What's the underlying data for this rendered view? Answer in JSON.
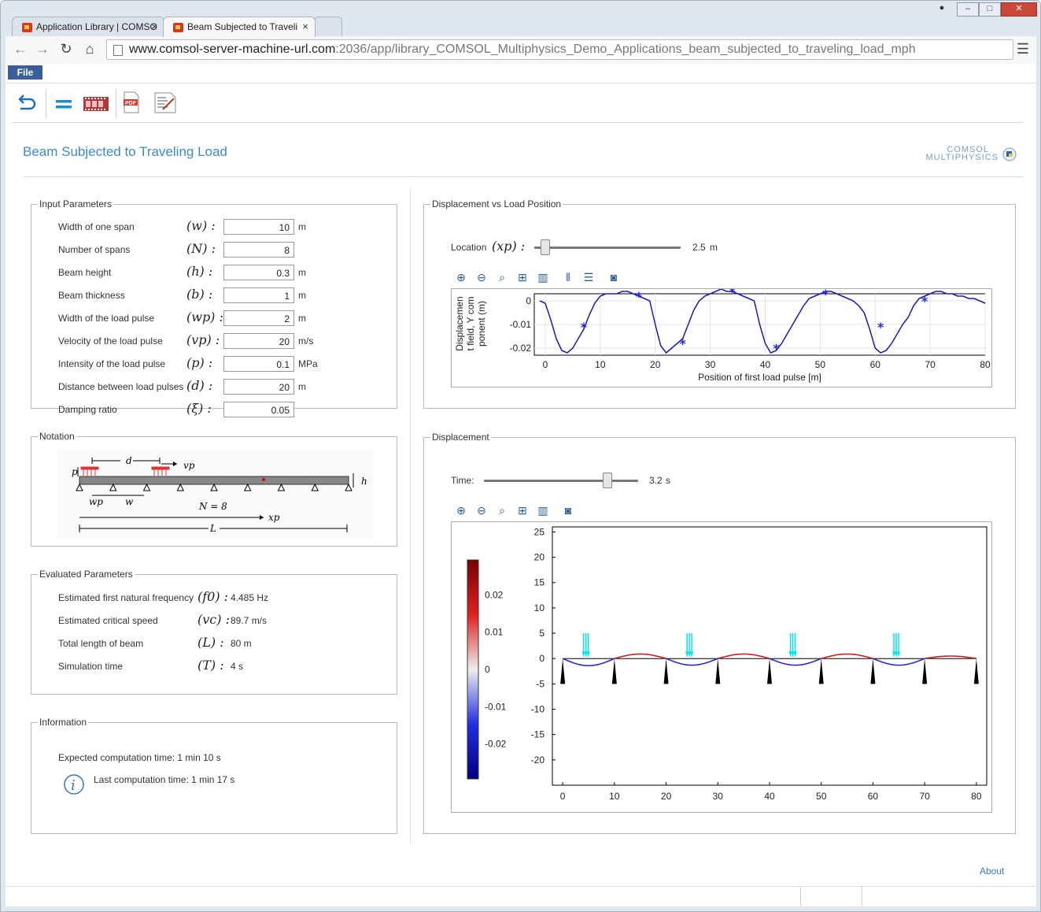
{
  "browser": {
    "tabs": [
      {
        "label": "Application Library | COMSO"
      },
      {
        "label": "Beam Subjected to Traveli"
      }
    ],
    "url_host": "www.comsol-server-machine-url.com",
    "url_rest": ":2036/app/library_COMSOL_Multiphysics_Demo_Applications_beam_subjected_to_traveling_load_mph"
  },
  "menu": {
    "file": "File"
  },
  "toolbar": {
    "icons": [
      "undo-icon",
      "equals-icon",
      "filmstrip-icon",
      "pdf-icon",
      "report-icon"
    ]
  },
  "header": {
    "title": "Beam Subjected to Traveling Load",
    "logo_line1": "COMSOL",
    "logo_line2": "MULTIPHYSICS"
  },
  "input": {
    "legend": "Input Parameters",
    "rows": [
      {
        "label": "Width of one span",
        "sym": "(w) :",
        "value": "10",
        "unit": "m"
      },
      {
        "label": "Number of spans",
        "sym": "(N) :",
        "value": "8",
        "unit": ""
      },
      {
        "label": "Beam height",
        "sym": "(h) :",
        "value": "0.3",
        "unit": "m"
      },
      {
        "label": "Beam thickness",
        "sym": "(b) :",
        "value": "1",
        "unit": "m"
      },
      {
        "label": "Width of the load pulse",
        "sym": "(wp) :",
        "value": "2",
        "unit": "m"
      },
      {
        "label": "Velocity of the load pulse",
        "sym": "(vp) :",
        "value": "20",
        "unit": "m/s"
      },
      {
        "label": "Intensity of the load pulse",
        "sym": "(p) :",
        "value": "0.1",
        "unit": "MPa"
      },
      {
        "label": "Distance between load pulses",
        "sym": "(d) :",
        "value": "20",
        "unit": "m"
      },
      {
        "label": "Damping ratio",
        "sym": "(ξ) :",
        "value": "0.05",
        "unit": ""
      }
    ]
  },
  "notation": {
    "legend": "Notation",
    "labels": {
      "p": "p",
      "d": "d",
      "vp": "vp",
      "h": "h",
      "wp": "wp",
      "w": "w",
      "N": "N = 8",
      "xp": "xp",
      "L": "L"
    }
  },
  "evaluated": {
    "legend": "Evaluated Parameters",
    "rows": [
      {
        "label": "Estimated first natural frequency",
        "sym": "(f0) :",
        "value": "4.485 Hz"
      },
      {
        "label": "Estimated critical speed",
        "sym": "(vc) :",
        "value": "89.7 m/s"
      },
      {
        "label": "Total length of beam",
        "sym": "(L) :",
        "value": "80 m"
      },
      {
        "label": "Simulation time",
        "sym": "(T) :",
        "value": "4 s"
      }
    ]
  },
  "information": {
    "legend": "Information",
    "expected": "Expected computation time: 1 min 10 s",
    "last": "Last computation time: 1 min 17 s"
  },
  "plot1": {
    "legend": "Displacement vs Load Position",
    "slider_label": "Location",
    "slider_sym": "(xp) :",
    "slider_value": "2.5",
    "slider_unit": "m",
    "slider_fraction": 0.03,
    "tools": [
      "zoom-in-icon",
      "zoom-out-icon",
      "zoom-box-icon",
      "zoom-extents-icon",
      "color-legend-icon",
      "grid-x-icon",
      "grid-y-icon",
      "camera-icon"
    ]
  },
  "plot2": {
    "legend": "Displacement",
    "slider_label": "Time:",
    "slider_value": "3.2",
    "slider_unit": "s",
    "slider_fraction": 0.8,
    "tools": [
      "zoom-in-icon",
      "zoom-out-icon",
      "zoom-box-icon",
      "zoom-extents-icon",
      "color-legend-icon",
      "camera-icon"
    ]
  },
  "footer": {
    "about": "About"
  },
  "chart_data": [
    {
      "type": "line",
      "title": "",
      "xlabel": "Position of first load pulse [m]",
      "ylabel": "Displacement field, Y component (m)",
      "xlim": [
        -2,
        80
      ],
      "ylim": [
        -0.023,
        0.003
      ],
      "xticks": [
        0,
        10,
        20,
        30,
        40,
        50,
        60,
        70,
        80
      ],
      "yticks": [
        0,
        -0.01,
        -0.02
      ],
      "ytick_labels": [
        "0",
        "-0.01",
        "-0.02"
      ],
      "grid": true,
      "series": [
        {
          "x": [
            -1,
            0,
            1,
            2,
            3,
            4,
            5,
            6,
            7,
            8,
            9,
            10,
            11,
            12,
            13,
            14,
            15,
            16,
            17,
            18,
            19,
            20,
            21,
            22,
            23,
            24,
            25,
            26,
            27,
            28,
            29,
            30,
            31,
            32,
            33,
            34,
            35,
            36,
            37,
            38,
            39,
            40,
            41,
            42,
            43,
            44,
            45,
            46,
            47,
            48,
            49,
            50,
            51,
            52,
            53,
            54,
            55,
            56,
            57,
            58,
            59,
            60,
            61,
            62,
            63,
            64,
            65,
            66,
            67,
            68,
            69,
            70,
            71,
            72,
            73,
            74,
            75,
            76,
            77,
            78,
            79,
            80
          ],
          "y": [
            0,
            -0.001,
            -0.008,
            -0.016,
            -0.021,
            -0.022,
            -0.02,
            -0.016,
            -0.012,
            -0.006,
            -0.001,
            0.002,
            0.003,
            0.003,
            0.003,
            0.004,
            0.004,
            0.003,
            0.002,
            0.001,
            0.0,
            -0.01,
            -0.019,
            -0.022,
            -0.02,
            -0.018,
            -0.016,
            -0.01,
            -0.004,
            0.0,
            0.002,
            0.003,
            0.004,
            0.005,
            0.004,
            0.004,
            0.003,
            0.002,
            0.001,
            0.0,
            -0.01,
            -0.018,
            -0.022,
            -0.021,
            -0.018,
            -0.014,
            -0.01,
            -0.006,
            -0.002,
            0.001,
            0.002,
            0.003,
            0.004,
            0.004,
            0.003,
            0.002,
            0.001,
            0.0,
            -0.002,
            -0.005,
            -0.012,
            -0.02,
            -0.022,
            -0.021,
            -0.018,
            -0.014,
            -0.01,
            -0.007,
            -0.002,
            0.001,
            0.002,
            0.003,
            0.004,
            0.004,
            0.003,
            0.003,
            0.002,
            0.002,
            0.001,
            0.001,
            0.0,
            -0.001
          ]
        }
      ],
      "markers": {
        "x": [
          7,
          17,
          25,
          34,
          42,
          51,
          61,
          69
        ],
        "y": [
          -0.011,
          0.002,
          -0.018,
          0.004,
          -0.02,
          0.003,
          -0.011,
          0.0
        ]
      }
    },
    {
      "type": "line",
      "title": "",
      "xlim": [
        -2,
        82
      ],
      "ylim": [
        -25,
        26
      ],
      "xticks": [
        0,
        10,
        20,
        30,
        40,
        50,
        60,
        70,
        80
      ],
      "yticks": [
        25,
        20,
        15,
        10,
        5,
        0,
        -5,
        -10,
        -15,
        -20
      ],
      "colorbar_ticks": [
        "0.02",
        "0.01",
        "0",
        "-0.01",
        "-0.02"
      ],
      "supports_x": [
        0,
        10,
        20,
        30,
        40,
        50,
        60,
        70,
        80
      ],
      "load_arrows_x": [
        4.5,
        24.5,
        44.5,
        64.5
      ],
      "deflection_scale": 1,
      "beam": [
        {
          "x0": 0,
          "x1": 10,
          "amp": -1.4,
          "color": "#2a2ad0"
        },
        {
          "x0": 10,
          "x1": 20,
          "amp": 0.9,
          "color": "#c02020"
        },
        {
          "x0": 20,
          "x1": 30,
          "amp": -1.3,
          "color": "#2a2ad0"
        },
        {
          "x0": 30,
          "x1": 40,
          "amp": 0.9,
          "color": "#c02020"
        },
        {
          "x0": 40,
          "x1": 50,
          "amp": -1.3,
          "color": "#2a2ad0"
        },
        {
          "x0": 50,
          "x1": 60,
          "amp": 0.9,
          "color": "#c02020"
        },
        {
          "x0": 60,
          "x1": 70,
          "amp": -1.3,
          "color": "#2a2ad0"
        },
        {
          "x0": 70,
          "x1": 80,
          "amp": 0.5,
          "color": "#c02020"
        }
      ]
    }
  ]
}
